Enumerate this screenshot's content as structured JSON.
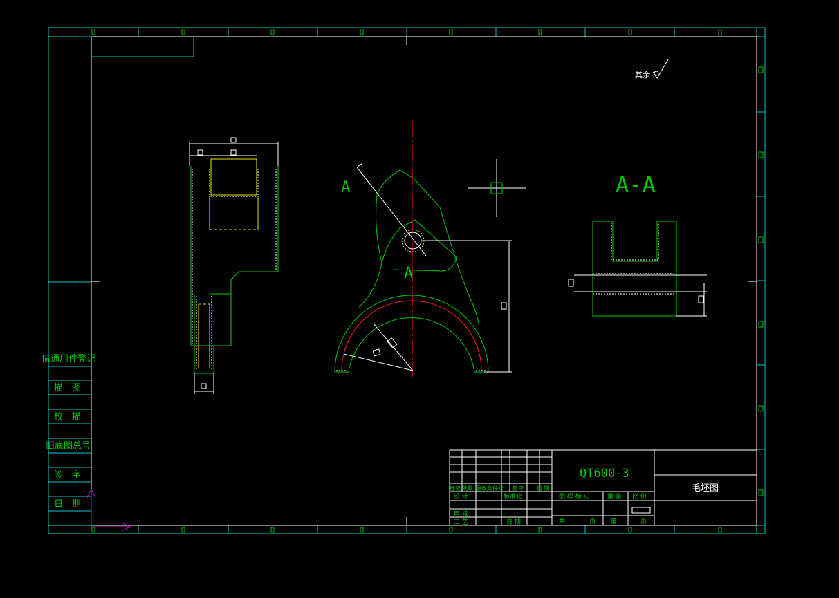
{
  "colors": {
    "background": "#000000",
    "frame": "#00c8c8",
    "border": "#ffffff",
    "part": "#00c800",
    "inner": "#e6e600",
    "centerline": "#ff2020",
    "text": "#00c800",
    "ucs": "#c800c8"
  },
  "drawing": {
    "roughness_label": "其余",
    "section_title": "A-A",
    "section_mark_1": "A",
    "section_mark_2": "A"
  },
  "sidebar": {
    "items": [
      {
        "label": "借通用件登记"
      },
      {
        "label": "描　图"
      },
      {
        "label": "校　描"
      },
      {
        "label": "旧底图总号"
      },
      {
        "label": "签　字"
      },
      {
        "label": "日　期"
      }
    ]
  },
  "title_block": {
    "material": "QT600-3",
    "drawing_name": "毛坯图",
    "revision_headers": [
      "标记",
      "处数",
      "更改文件号",
      "签 字",
      "日 期"
    ],
    "design_label": "设 计",
    "standardize_label": "标准化",
    "review_label": "审 核",
    "process_label": "工 艺",
    "date_label": "日 期",
    "stage_mark_label": "图 样 标 记",
    "weight_label": "重 量",
    "scale_label": "比 例",
    "total_label": "共",
    "sheet_label": "页",
    "no_label": "第",
    "page_label": "页"
  }
}
